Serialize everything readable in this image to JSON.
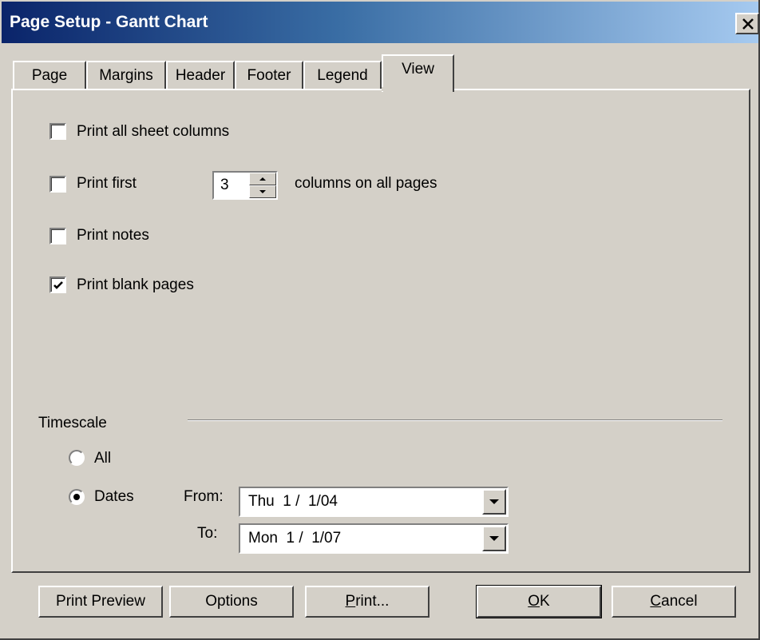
{
  "window": {
    "title": "Page Setup - Gantt Chart"
  },
  "tabs": [
    {
      "label": "Page"
    },
    {
      "label": "Margins"
    },
    {
      "label": "Header"
    },
    {
      "label": "Footer"
    },
    {
      "label": "Legend"
    },
    {
      "label": "View",
      "active": true
    }
  ],
  "view": {
    "print_all_columns": {
      "label": "Print all sheet columns",
      "checked": false
    },
    "print_first": {
      "label": "Print first",
      "checked": false,
      "value": "3",
      "suffix": "columns on all pages"
    },
    "print_notes": {
      "label": "Print notes",
      "checked": false
    },
    "print_blank_pages": {
      "label": "Print blank pages",
      "checked": true
    }
  },
  "timescale": {
    "heading": "Timescale",
    "all_label": "All",
    "dates_label": "Dates",
    "selected": "Dates",
    "from_label": "From:",
    "from_value": "Thu  1 /  1/04",
    "to_label": "To:",
    "to_value": "Mon  1 /  1/07"
  },
  "buttons": {
    "print_preview": "Print Preview",
    "options": "Options",
    "print": {
      "mnemonic": "P",
      "rest": "rint..."
    },
    "ok": {
      "mnemonic": "O",
      "rest": "K"
    },
    "cancel": {
      "mnemonic": "C",
      "rest": "ancel"
    }
  },
  "colors": {
    "face": "#d4d0c8",
    "title_start": "#0a246a",
    "title_end": "#a6caf0"
  }
}
